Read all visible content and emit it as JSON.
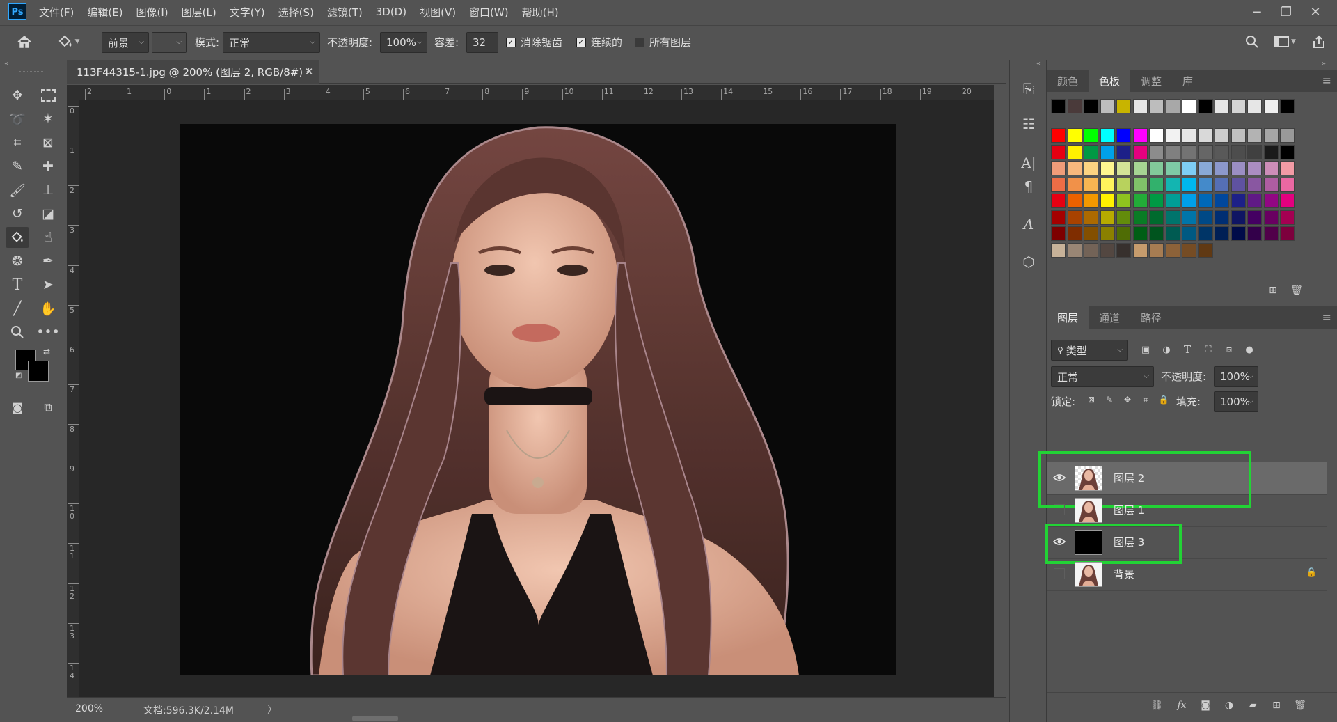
{
  "app": {
    "logo": "Ps"
  },
  "menu": [
    "文件(F)",
    "编辑(E)",
    "图像(I)",
    "图层(L)",
    "文字(Y)",
    "选择(S)",
    "滤镜(T)",
    "3D(D)",
    "视图(V)",
    "窗口(W)",
    "帮助(H)"
  ],
  "window_controls": {
    "minimize": "−",
    "restore": "❐",
    "close": "✕"
  },
  "options": {
    "fill_source": "前景",
    "mode_label": "模式:",
    "mode_value": "正常",
    "opacity_label": "不透明度:",
    "opacity_value": "100%",
    "tolerance_label": "容差:",
    "tolerance_value": "32",
    "antialias_label": "消除锯齿",
    "antialias_checked": true,
    "contiguous_label": "连续的",
    "contiguous_checked": true,
    "all_layers_label": "所有图层",
    "all_layers_checked": false
  },
  "document": {
    "tab_title": "113F44315-1.jpg @ 200% (图层 2, RGB/8#) *",
    "zoom": "200%",
    "doc_info": "文档:596.3K/2.14M"
  },
  "rulers": {
    "h_ticks": [
      "2",
      "1",
      "0",
      "1",
      "2",
      "3",
      "4",
      "5",
      "6",
      "7",
      "8",
      "9",
      "10",
      "11",
      "12",
      "13",
      "14",
      "15",
      "16",
      "17",
      "18",
      "19",
      "20"
    ],
    "v_ticks": [
      "0",
      "1",
      "2",
      "3",
      "4",
      "5",
      "6",
      "7",
      "8",
      "9",
      "1 0",
      "1 1",
      "1 2",
      "1 3",
      "1 4"
    ]
  },
  "swatches_panel": {
    "tabs": [
      "颜色",
      "色板",
      "调整",
      "库"
    ],
    "active_tab": "色板",
    "recent": [
      "#000000",
      "#4a3a3a",
      "#000000",
      "#bdbdbd",
      "#c8b400",
      "#e6e6e6",
      "#bdbdbd",
      "#a8a8a8",
      "#ffffff",
      "#000000",
      "#e6e6e6",
      "#d4d4d4",
      "#e6e6e6",
      "#f0f0f0",
      "#000000"
    ],
    "rows": [
      [
        "#ff0000",
        "#ffff00",
        "#00ff00",
        "#00ffff",
        "#0000ff",
        "#ff00ff",
        "#ffffff",
        "#f2f2f2",
        "#e6e6e6",
        "#d9d9d9",
        "#cccccc",
        "#c0c0c0",
        "#b3b3b3",
        "#a6a6a6",
        "#999999"
      ],
      [
        "#e60012",
        "#fff100",
        "#009944",
        "#00a0e9",
        "#1d2088",
        "#e4007f",
        "#8c8c8c",
        "#808080",
        "#737373",
        "#666666",
        "#595959",
        "#4d4d4d",
        "#404040",
        "#1a1a1a",
        "#000000"
      ],
      [
        "#f19c79",
        "#f8b87d",
        "#fcd382",
        "#fff68f",
        "#d4e497",
        "#a6d493",
        "#82c99a",
        "#7ecaa6",
        "#7ecdf4",
        "#89a9d6",
        "#8c98cc",
        "#9b8ec3",
        "#ab8dc1",
        "#cd8db8",
        "#f29ba5"
      ],
      [
        "#ed6d46",
        "#f19149",
        "#f7b552",
        "#fff45c",
        "#b8d25d",
        "#80c269",
        "#32b16c",
        "#13b5b1",
        "#00b7ee",
        "#448aca",
        "#556fb5",
        "#5f52a0",
        "#8957a1",
        "#ae5da1",
        "#ea68a2"
      ],
      [
        "#e60012",
        "#eb6100",
        "#f39800",
        "#fff100",
        "#8fc31f",
        "#22ac38",
        "#009944",
        "#009e96",
        "#00a0e9",
        "#0068b7",
        "#00479d",
        "#1d2088",
        "#601986",
        "#920783",
        "#e4007f"
      ],
      [
        "#a40000",
        "#a84200",
        "#ac6a00",
        "#b7aa00",
        "#638c0b",
        "#097c25",
        "#006b2e",
        "#00746c",
        "#0075a9",
        "#004986",
        "#002e73",
        "#0f1563",
        "#440062",
        "#690061",
        "#a40052"
      ],
      [
        "#7d0000",
        "#7f2d00",
        "#834f00",
        "#8a8000",
        "#4f6c05",
        "#005e15",
        "#00541e",
        "#005b52",
        "#005982",
        "#003567",
        "#001f55",
        "#000b49",
        "#33004a",
        "#51004a",
        "#7d003d"
      ],
      [
        "#c7b299",
        "#998675",
        "#736357",
        "#534741",
        "#37302d",
        "#c69c6d",
        "#a67c52",
        "#8c6239",
        "#754c24",
        "#603913"
      ]
    ]
  },
  "layers_panel": {
    "tabs": [
      "图层",
      "通道",
      "路径"
    ],
    "active_tab": "图层",
    "filter_label": "类型",
    "blend_mode": "正常",
    "opacity_label": "不透明度:",
    "opacity_value": "100%",
    "lock_label": "锁定:",
    "fill_label": "填充:",
    "fill_value": "100%",
    "layers": [
      {
        "name": "图层 2",
        "visible": true,
        "selected": true,
        "thumb": "portrait",
        "locked": false,
        "highlighted": true
      },
      {
        "name": "图层 1",
        "visible": false,
        "selected": false,
        "thumb": "portrait",
        "locked": false,
        "highlighted": false
      },
      {
        "name": "图层 3",
        "visible": true,
        "selected": false,
        "thumb": "black",
        "locked": false,
        "highlighted": true
      },
      {
        "name": "背景",
        "visible": false,
        "selected": false,
        "thumb": "portrait",
        "locked": true,
        "highlighted": false
      }
    ]
  },
  "highlight_color": "#22d335"
}
